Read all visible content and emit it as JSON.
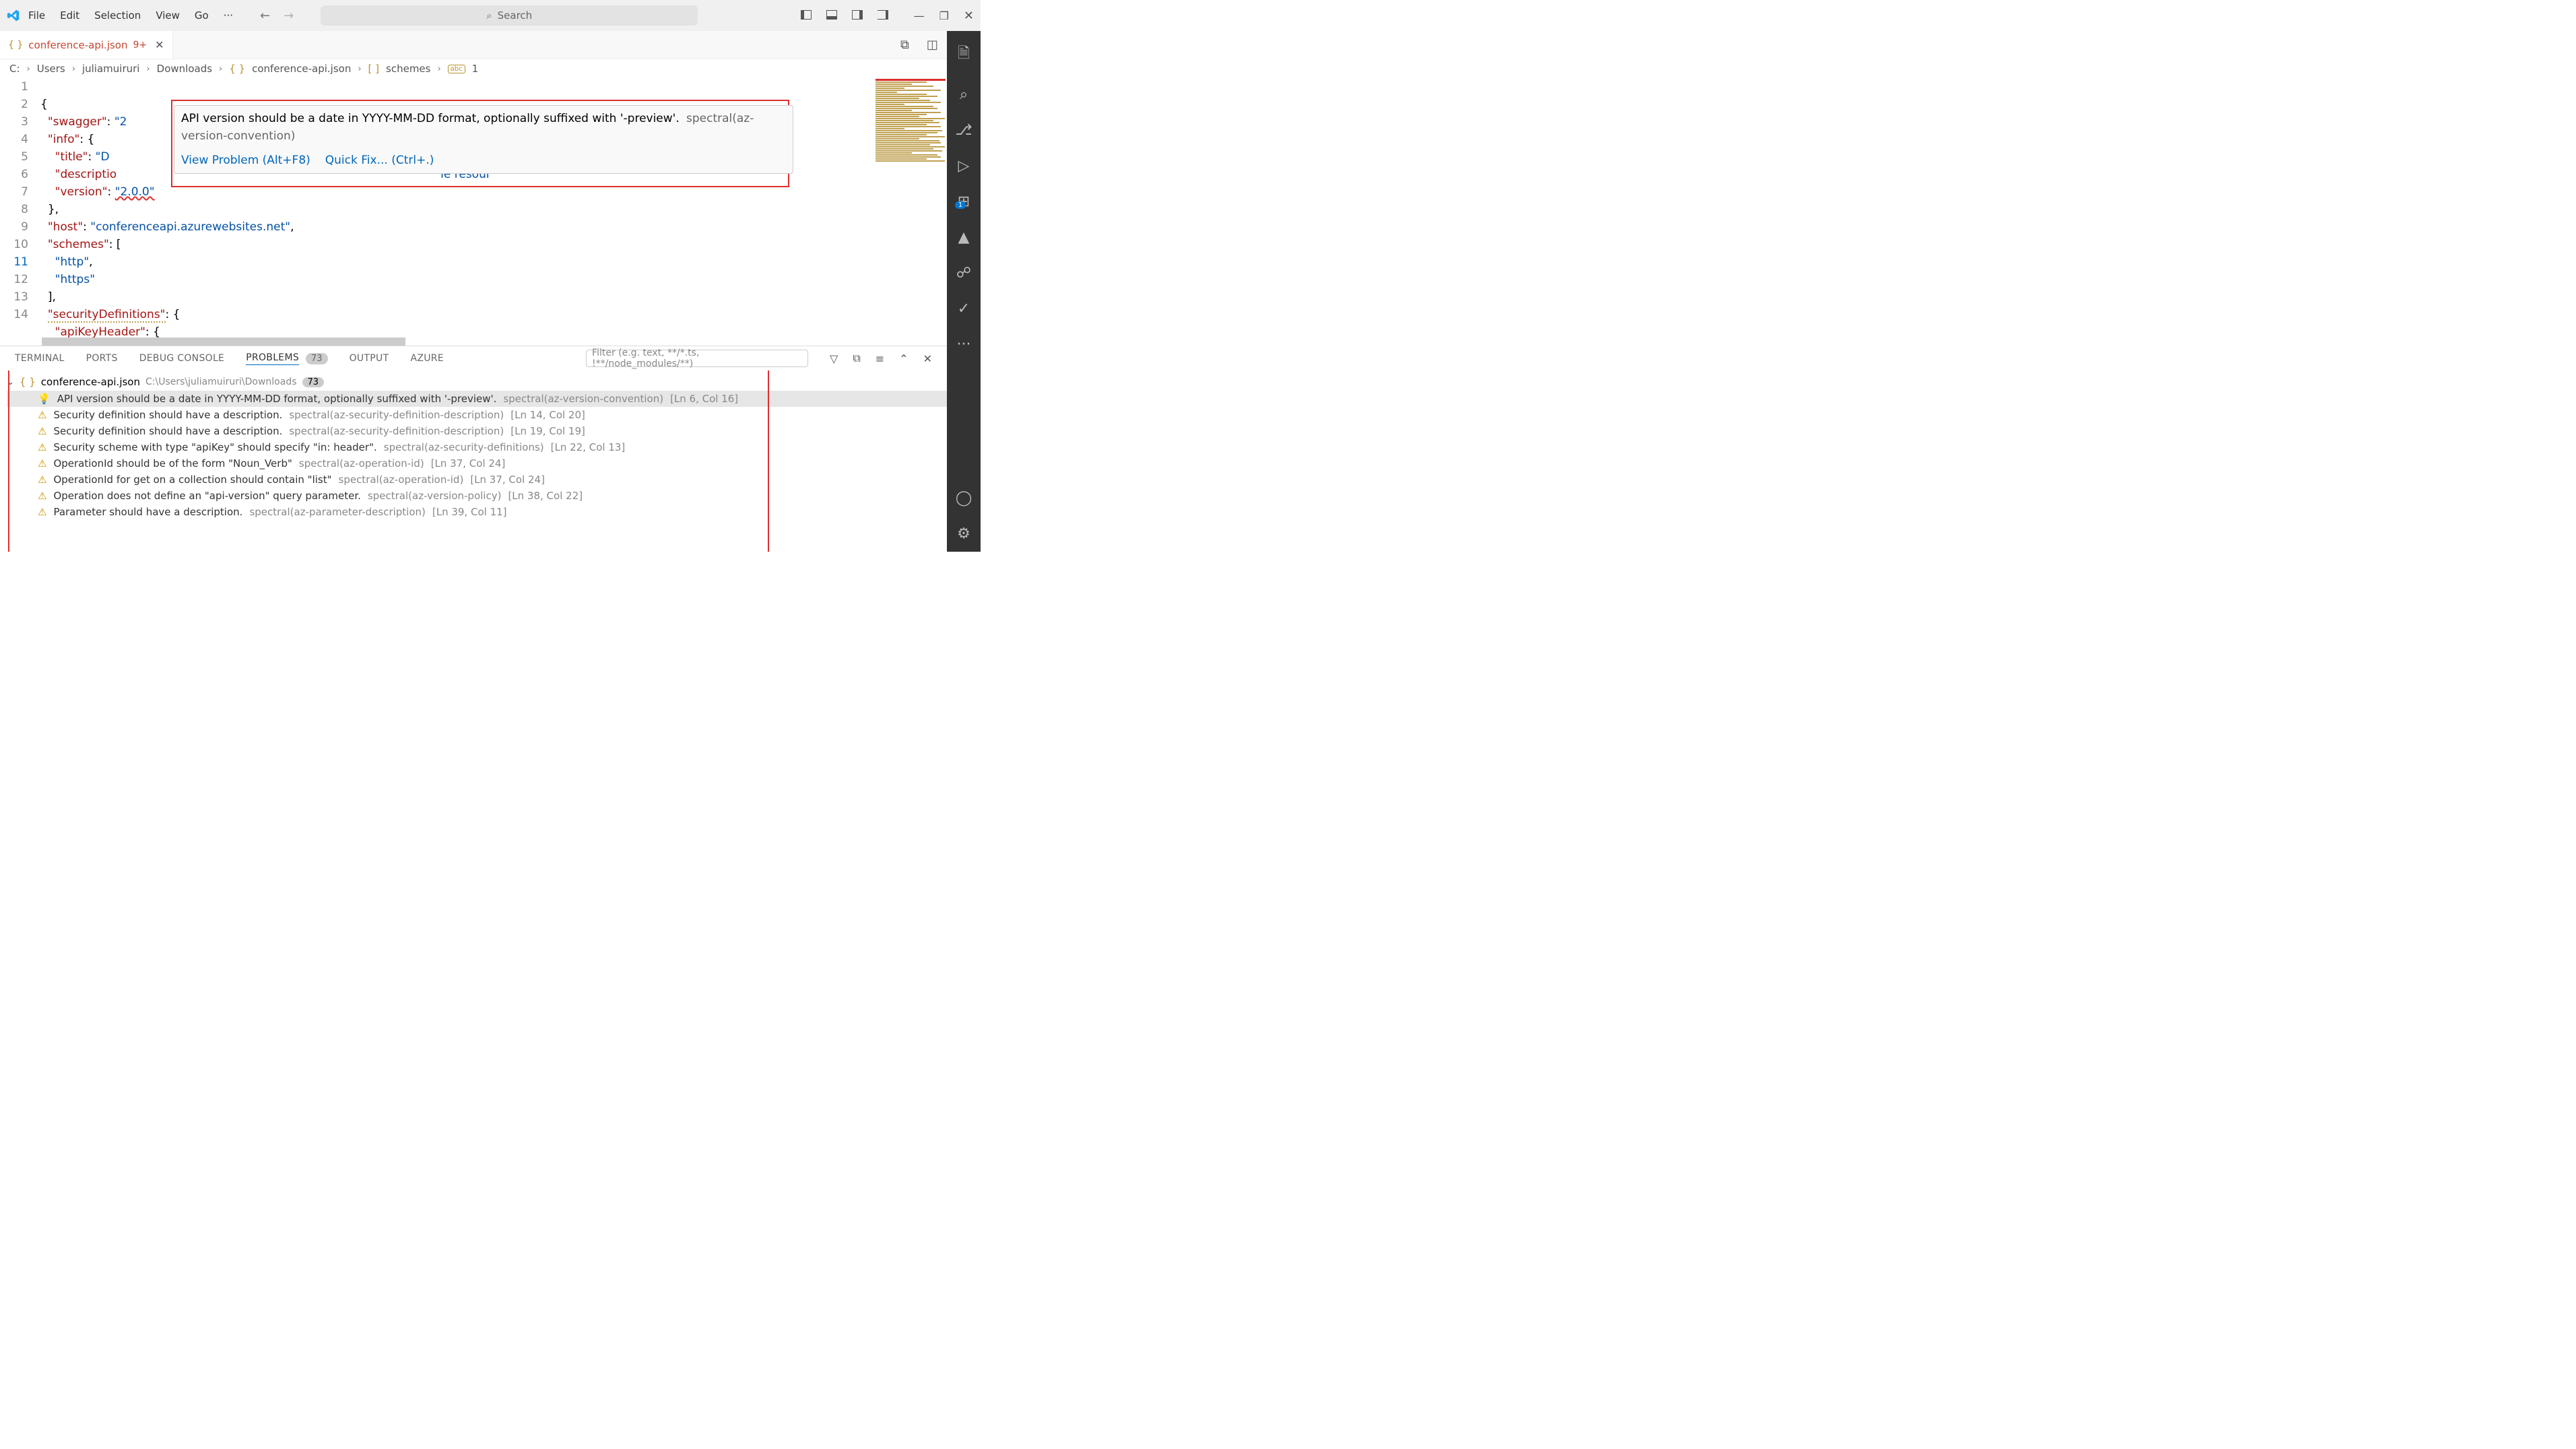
{
  "menubar": [
    "File",
    "Edit",
    "Selection",
    "View",
    "Go",
    "···"
  ],
  "search": {
    "placeholder": "Search"
  },
  "tab": {
    "filename": "conference-api.json",
    "dirty_marker": "9+"
  },
  "breadcrumb": [
    "C:",
    "Users",
    "juliamuiruri",
    "Downloads",
    "conference-api.json",
    "schemes",
    "1"
  ],
  "gutter": [
    "1",
    "2",
    "3",
    "4",
    "5",
    "6",
    "7",
    "8",
    "9",
    "10",
    "11",
    "12",
    "13",
    "14"
  ],
  "gutter_current": "11",
  "code": {
    "l1": "{",
    "l2_k": "\"swagger\"",
    "l2_p": ": ",
    "l2_v": "\"2",
    "l3_k": "\"info\"",
    "l3_p": ": {",
    "l4_k": "\"title\"",
    "l4_p": ": ",
    "l4_v": "\"D",
    "l5_k": "\"descriptio",
    "l5_trail": "le resour",
    "l6_k": "\"version\"",
    "l6_p": ": ",
    "l6_v": "\"2.0.0\"",
    "l7": "},",
    "l8_k": "\"host\"",
    "l8_p": ": ",
    "l8_v": "\"conferenceapi.azurewebsites.net\"",
    "l8_c": ",",
    "l9_k": "\"schemes\"",
    "l9_p": ": [",
    "l10_v": "\"http\"",
    "l10_c": ",",
    "l11_v": "\"https\"",
    "l12": "],",
    "l13_k": "\"securityDefinitions\"",
    "l13_p": ": {",
    "l14_k": "\"apiKeyHeader\"",
    "l14_p": ": {"
  },
  "hover": {
    "msg": "API version should be a date in YYYY-MM-DD format, optionally suffixed with '-preview'.",
    "rule": "spectral(az-version-convention)",
    "link_view": "View Problem (Alt+F8)",
    "link_fix": "Quick Fix... (Ctrl+.)"
  },
  "panel_tabs": {
    "terminal": "TERMINAL",
    "ports": "PORTS",
    "debug": "DEBUG CONSOLE",
    "problems": "PROBLEMS",
    "output": "OUTPUT",
    "azure": "AZURE",
    "badge": "73"
  },
  "filter": {
    "placeholder": "Filter (e.g. text, **/*.ts, !**/node_modules/**)"
  },
  "problems_header": {
    "file": "conference-api.json",
    "path": "C:\\Users\\juliamuiruri\\Downloads",
    "count": "73"
  },
  "problems": [
    {
      "type": "info",
      "msg": "API version should be a date in YYYY-MM-DD format, optionally suffixed with '-preview'.",
      "rule": "spectral(az-version-convention)",
      "loc": "[Ln 6, Col 16]"
    },
    {
      "type": "warn",
      "msg": "Security definition should have a description.",
      "rule": "spectral(az-security-definition-description)",
      "loc": "[Ln 14, Col 20]"
    },
    {
      "type": "warn",
      "msg": "Security definition should have a description.",
      "rule": "spectral(az-security-definition-description)",
      "loc": "[Ln 19, Col 19]"
    },
    {
      "type": "warn",
      "msg": "Security scheme with type \"apiKey\" should specify \"in: header\".",
      "rule": "spectral(az-security-definitions)",
      "loc": "[Ln 22, Col 13]"
    },
    {
      "type": "warn",
      "msg": "OperationId should be of the form \"Noun_Verb\"",
      "rule": "spectral(az-operation-id)",
      "loc": "[Ln 37, Col 24]"
    },
    {
      "type": "warn",
      "msg": "OperationId for get on a collection should contain \"list\"",
      "rule": "spectral(az-operation-id)",
      "loc": "[Ln 37, Col 24]"
    },
    {
      "type": "warn",
      "msg": "Operation does not define an \"api-version\" query parameter.",
      "rule": "spectral(az-version-policy)",
      "loc": "[Ln 38, Col 22]"
    },
    {
      "type": "warn",
      "msg": "Parameter should have a description.",
      "rule": "spectral(az-parameter-description)",
      "loc": "[Ln 39, Col 11]"
    }
  ],
  "ext_badge": "1"
}
